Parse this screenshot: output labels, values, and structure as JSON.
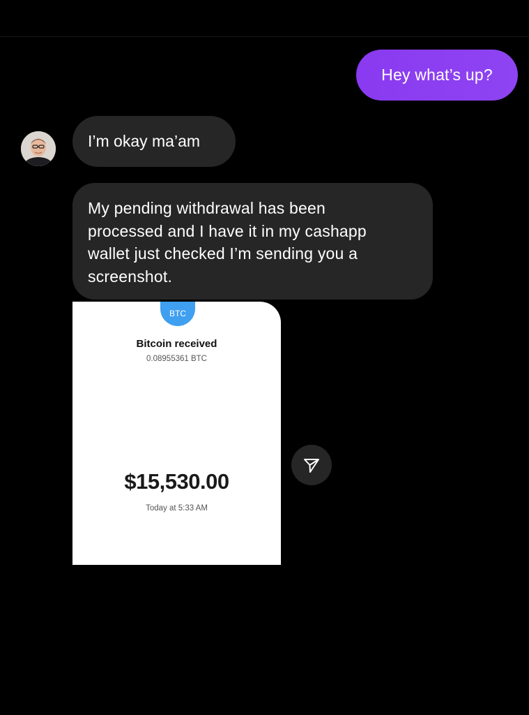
{
  "thread": {
    "outgoing": [
      {
        "text": "Hey what’s up?"
      }
    ],
    "incoming": [
      {
        "text": "I’m okay ma’am"
      },
      {
        "lines": [
          "My pending withdrawal has been",
          "processed and I have it in my cashapp",
          "wallet just checked I’m sending you a",
          "screenshot."
        ]
      }
    ]
  },
  "screenshot": {
    "badge": "BTC",
    "title": "Bitcoin received",
    "btc_amount": "0.08955361 BTC",
    "usd_amount": "$15,530.00",
    "timestamp": "Today at 5:33 AM"
  },
  "icons": {
    "share": "paper-plane-icon",
    "avatar": "avatar"
  },
  "colors": {
    "background": "#000000",
    "outgoing_bubble": "#8b3ff1",
    "incoming_bubble": "#262626",
    "btc_badge": "#3f9ff0"
  }
}
